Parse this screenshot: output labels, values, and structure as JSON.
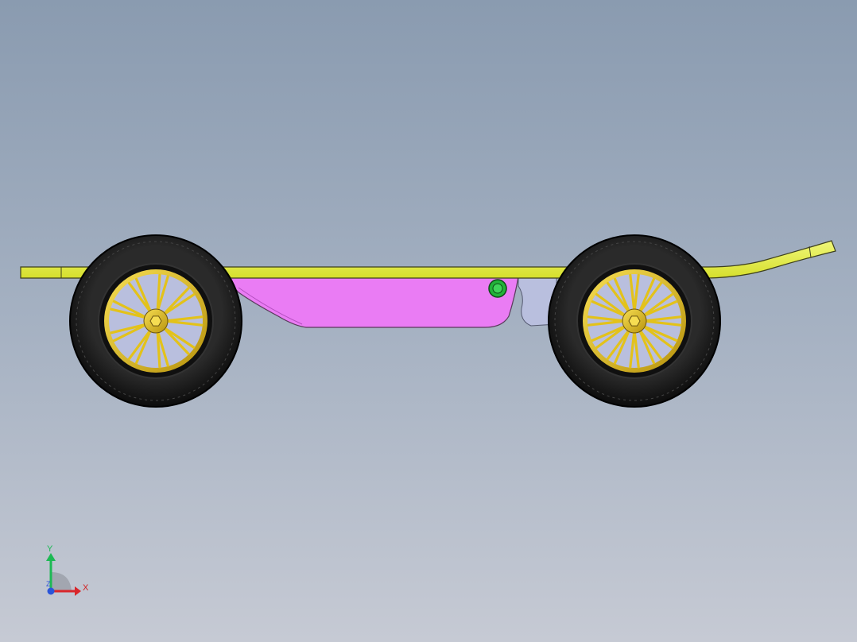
{
  "viewport": {
    "background_top": "#8a9bb0",
    "background_bottom": "#c6cad4"
  },
  "model": {
    "deck_color": "#e6f04a",
    "motor_housing_color": "#ea7cf4",
    "bracket_color": "#b9bfde",
    "tire_color": "#1a1a1a",
    "rim_color": "#e3c21a",
    "knob_color": "#22b33a"
  },
  "triad": {
    "y_label": "Y",
    "x_label": "X",
    "z_label": "Z",
    "y_color": "#1db954",
    "x_color": "#d9262b",
    "z_color": "#2b55d9"
  }
}
